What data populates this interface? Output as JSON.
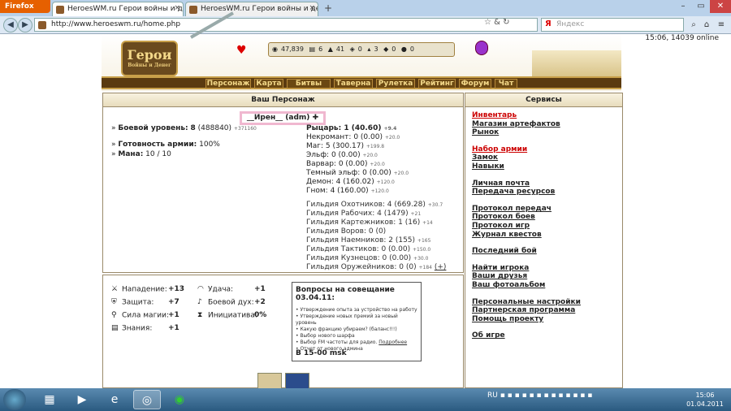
{
  "browser": {
    "app_button": "Firefox",
    "tabs": [
      {
        "title": "HeroesWM.ru Герои войны и денег..."
      },
      {
        "title": "HeroesWM.ru Герои войны и денег..."
      }
    ],
    "new_tab": "+",
    "url": "http://www.heroeswm.ru/home.php",
    "search_engine": "Я",
    "search_placeholder": "Яндекс"
  },
  "game_header": {
    "logo_text": "Герои",
    "logo_sub": "Войны и Денег",
    "resources": [
      {
        "icon": "gold-icon",
        "value": "47,839"
      },
      {
        "icon": "wood-icon",
        "value": "6"
      },
      {
        "icon": "ore-icon",
        "value": "41"
      },
      {
        "icon": "mercury-icon",
        "value": "0"
      },
      {
        "icon": "sulfur-icon",
        "value": "3"
      },
      {
        "icon": "crystal-icon",
        "value": "0"
      },
      {
        "icon": "gem-icon",
        "value": "0"
      }
    ],
    "clock": "15:06, 14039 online",
    "nav": [
      "Персонаж",
      "Карта",
      "Битвы",
      "Таверна",
      "Рулетка",
      "Рейтинг",
      "Форум",
      "Чат"
    ]
  },
  "character": {
    "panel_title": "Ваш Персонаж",
    "name": "__Ирен__ (adm)",
    "combat_level_label": "Боевой уровень:",
    "combat_level": "8",
    "combat_level_exp": "(488840)",
    "combat_level_delta": "+371160",
    "army_ready_label": "Готовность армии:",
    "army_ready": "100%",
    "mana_label": "Мана:",
    "mana": "10 / 10",
    "factions": [
      {
        "name": "Рыцарь:",
        "value": "1 (40.60)",
        "delta": "+9.4",
        "bold": true
      },
      {
        "name": "Некромант:",
        "value": "0 (0.00)",
        "delta": "+20.0",
        "bold": false
      },
      {
        "name": "Маг:",
        "value": "5 (300.17)",
        "delta": "+199.8",
        "bold": false
      },
      {
        "name": "Эльф:",
        "value": "0 (0.00)",
        "delta": "+20.0",
        "bold": false
      },
      {
        "name": "Варвар:",
        "value": "0 (0.00)",
        "delta": "+20.0",
        "bold": false
      },
      {
        "name": "Темный эльф:",
        "value": "0 (0.00)",
        "delta": "+20.0",
        "bold": false
      },
      {
        "name": "Демон:",
        "value": "4 (160.02)",
        "delta": "+120.0",
        "bold": false
      },
      {
        "name": "Гном:",
        "value": "4 (160.00)",
        "delta": "+120.0",
        "bold": false
      }
    ],
    "guilds": [
      {
        "name": "Гильдия Охотников:",
        "value": "4 (669.28)",
        "delta": "+30.7"
      },
      {
        "name": "Гильдия Рабочих:",
        "value": "4 (1479)",
        "delta": "+21"
      },
      {
        "name": "Гильдия Картежников:",
        "value": "1 (16)",
        "delta": "+14"
      },
      {
        "name": "Гильдия Воров:",
        "value": "0 (0)",
        "delta": ""
      },
      {
        "name": "Гильдия Наемников:",
        "value": "2 (155)",
        "delta": "+165"
      },
      {
        "name": "Гильдия Тактиков:",
        "value": "0 (0.00)",
        "delta": "+150.0"
      },
      {
        "name": "Гильдия Кузнецов:",
        "value": "0 (0.00)",
        "delta": "+30.0"
      },
      {
        "name": "Гильдия Оружейников:",
        "value": "0 (0)",
        "delta": "+184"
      }
    ],
    "expand": "(+)"
  },
  "skills": {
    "left": [
      {
        "icon": "sword-icon",
        "label": "Нападение:",
        "value": "+13"
      },
      {
        "icon": "shield-icon",
        "label": "Защита:",
        "value": "+7"
      },
      {
        "icon": "wand-icon",
        "label": "Сила магии:",
        "value": "+1"
      },
      {
        "icon": "book-icon",
        "label": "Знания:",
        "value": "+1"
      }
    ],
    "right": [
      {
        "icon": "rainbow-icon",
        "label": "Удача:",
        "value": "+1"
      },
      {
        "icon": "horn-icon",
        "label": "Боевой дух:",
        "value": "+2"
      },
      {
        "icon": "hourglass-icon",
        "label": "Инициатива:",
        "value": "0%"
      }
    ]
  },
  "questions": {
    "title": "Вопросы на совещание 03.04.11:",
    "items": [
      "Утверждение опыта за устройство на работу",
      "Утверждение новых премий за новый уровень",
      "Какую фракцию убираем? (баланс!!!)",
      "Выбор нового шарфа",
      "Выбор FM частоты для радио.",
      "Отчет от нового админа"
    ],
    "details_link": "Подробнее",
    "footer": "В 15-00 msk"
  },
  "services": {
    "panel_title": "Сервисы",
    "groups": [
      [
        {
          "label": "Инвентарь",
          "red": true
        },
        {
          "label": "Магазин артефактов"
        },
        {
          "label": "Рынок"
        }
      ],
      [
        {
          "label": "Набор армии",
          "red": true
        },
        {
          "label": "Замок"
        },
        {
          "label": "Навыки"
        }
      ],
      [
        {
          "label": "Личная почта"
        },
        {
          "label": "Передача ресурсов"
        }
      ],
      [
        {
          "label": "Протокол передач"
        },
        {
          "label": "Протокол боев"
        },
        {
          "label": "Протокол игр"
        },
        {
          "label": "Журнал квестов"
        }
      ],
      [
        {
          "label": "Последний бой"
        }
      ],
      [
        {
          "label": "Найти игрока"
        },
        {
          "label": "Ваши друзья"
        },
        {
          "label": "Ваш фотоальбом"
        }
      ],
      [
        {
          "label": "Персональные настройки"
        },
        {
          "label": "Партнерская программа"
        },
        {
          "label": "Помощь проекту"
        }
      ],
      [
        {
          "label": "Об игре"
        }
      ]
    ]
  },
  "taskbar": {
    "lang": "RU",
    "time": "15:06",
    "date": "01.04.2011"
  },
  "colors": {
    "accent_red": "#cc0000",
    "gold": "#c8a04a",
    "nav_bg": "#5a3a10"
  }
}
